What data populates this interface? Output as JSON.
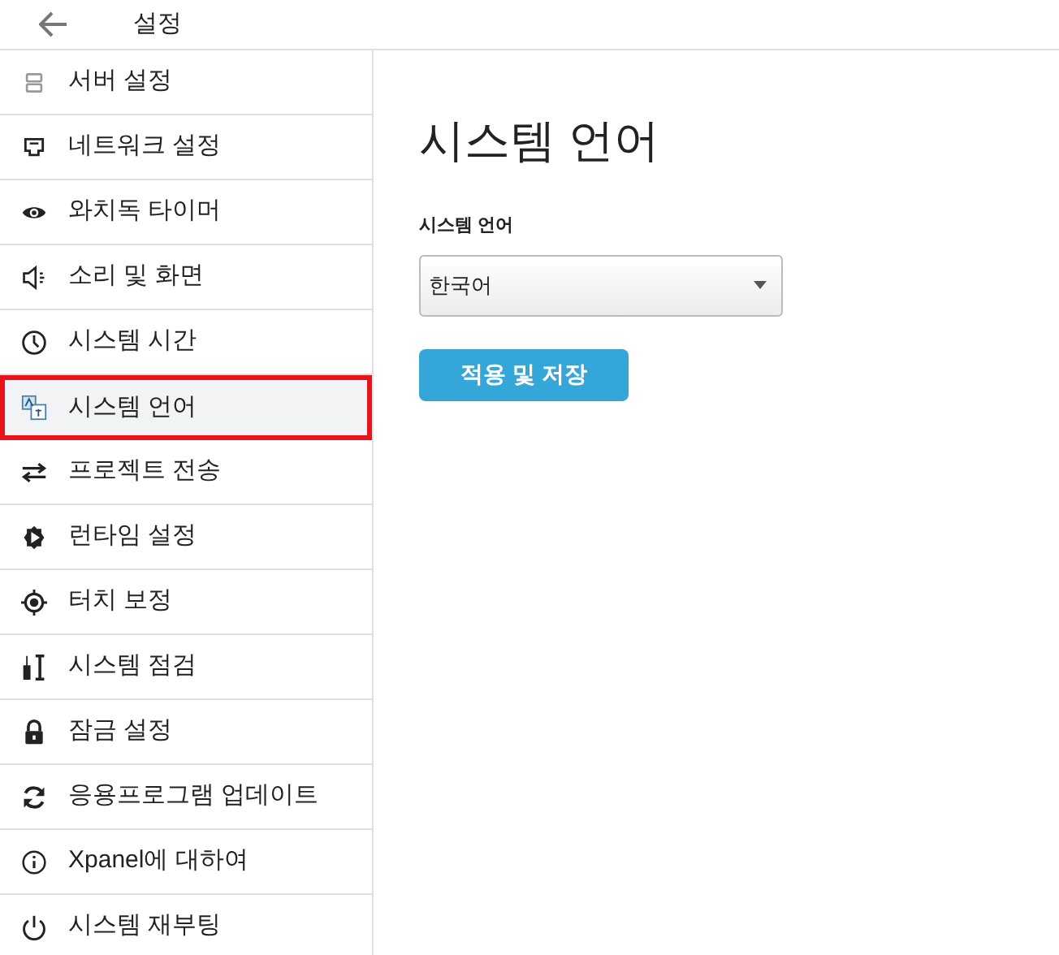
{
  "header": {
    "title": "설정"
  },
  "sidebar": {
    "items": [
      {
        "label": "서버 설정",
        "selected": false
      },
      {
        "label": "네트워크 설정",
        "selected": false
      },
      {
        "label": "와치독 타이머",
        "selected": false
      },
      {
        "label": "소리 및 화면",
        "selected": false
      },
      {
        "label": "시스템 시간",
        "selected": false
      },
      {
        "label": "시스템 언어",
        "selected": true
      },
      {
        "label": "프로젝트 전송",
        "selected": false
      },
      {
        "label": "런타임 설정",
        "selected": false
      },
      {
        "label": "터치 보정",
        "selected": false
      },
      {
        "label": "시스템 점검",
        "selected": false
      },
      {
        "label": "잠금 설정",
        "selected": false
      },
      {
        "label": "응용프로그램 업데이트",
        "selected": false
      },
      {
        "label": "Xpanel에 대하여",
        "selected": false
      },
      {
        "label": "시스템 재부팅",
        "selected": false
      }
    ]
  },
  "content": {
    "title": "시스템 언어",
    "field_label": "시스템 언어",
    "select_value": "한국어",
    "button": "적용 및 저장"
  }
}
